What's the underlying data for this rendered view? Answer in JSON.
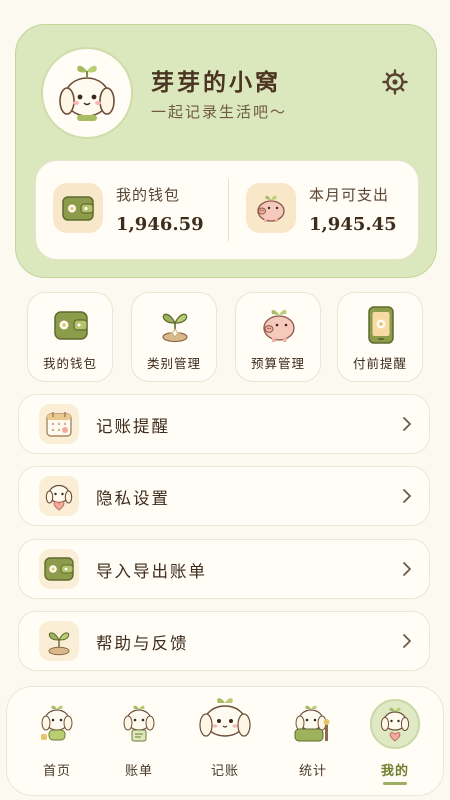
{
  "profile": {
    "nickname": "芽芽的小窝",
    "motto": "一起记录生活吧～",
    "wallet_label": "我的钱包",
    "wallet_amount": "1,946.59",
    "spendable_label": "本月可支出",
    "spendable_amount": "1,945.45"
  },
  "quick_actions": [
    {
      "label": "我的钱包",
      "icon": "wallet-icon"
    },
    {
      "label": "类别管理",
      "icon": "sprout-icon"
    },
    {
      "label": "预算管理",
      "icon": "piggy-bank-icon"
    },
    {
      "label": "付前提醒",
      "icon": "phone-icon"
    }
  ],
  "menu": [
    {
      "label": "记账提醒",
      "icon": "calendar-icon"
    },
    {
      "label": "隐私设置",
      "icon": "bunny-heart-icon"
    },
    {
      "label": "导入导出账单",
      "icon": "wallet-icon"
    },
    {
      "label": "帮助与反馈",
      "icon": "sprout-icon"
    }
  ],
  "nav": [
    {
      "label": "首页",
      "icon": "bunny-home-icon"
    },
    {
      "label": "账单",
      "icon": "bunny-bill-icon"
    },
    {
      "label": "记账",
      "icon": "bunny-add-icon"
    },
    {
      "label": "统计",
      "icon": "bunny-stats-icon"
    },
    {
      "label": "我的",
      "icon": "bunny-me-icon",
      "active": true
    }
  ],
  "colors": {
    "header_bg": "#dbe7bc",
    "accent": "#9cae5f",
    "page_bg": "#fbf9f0",
    "card_bg": "#fffdf6"
  }
}
